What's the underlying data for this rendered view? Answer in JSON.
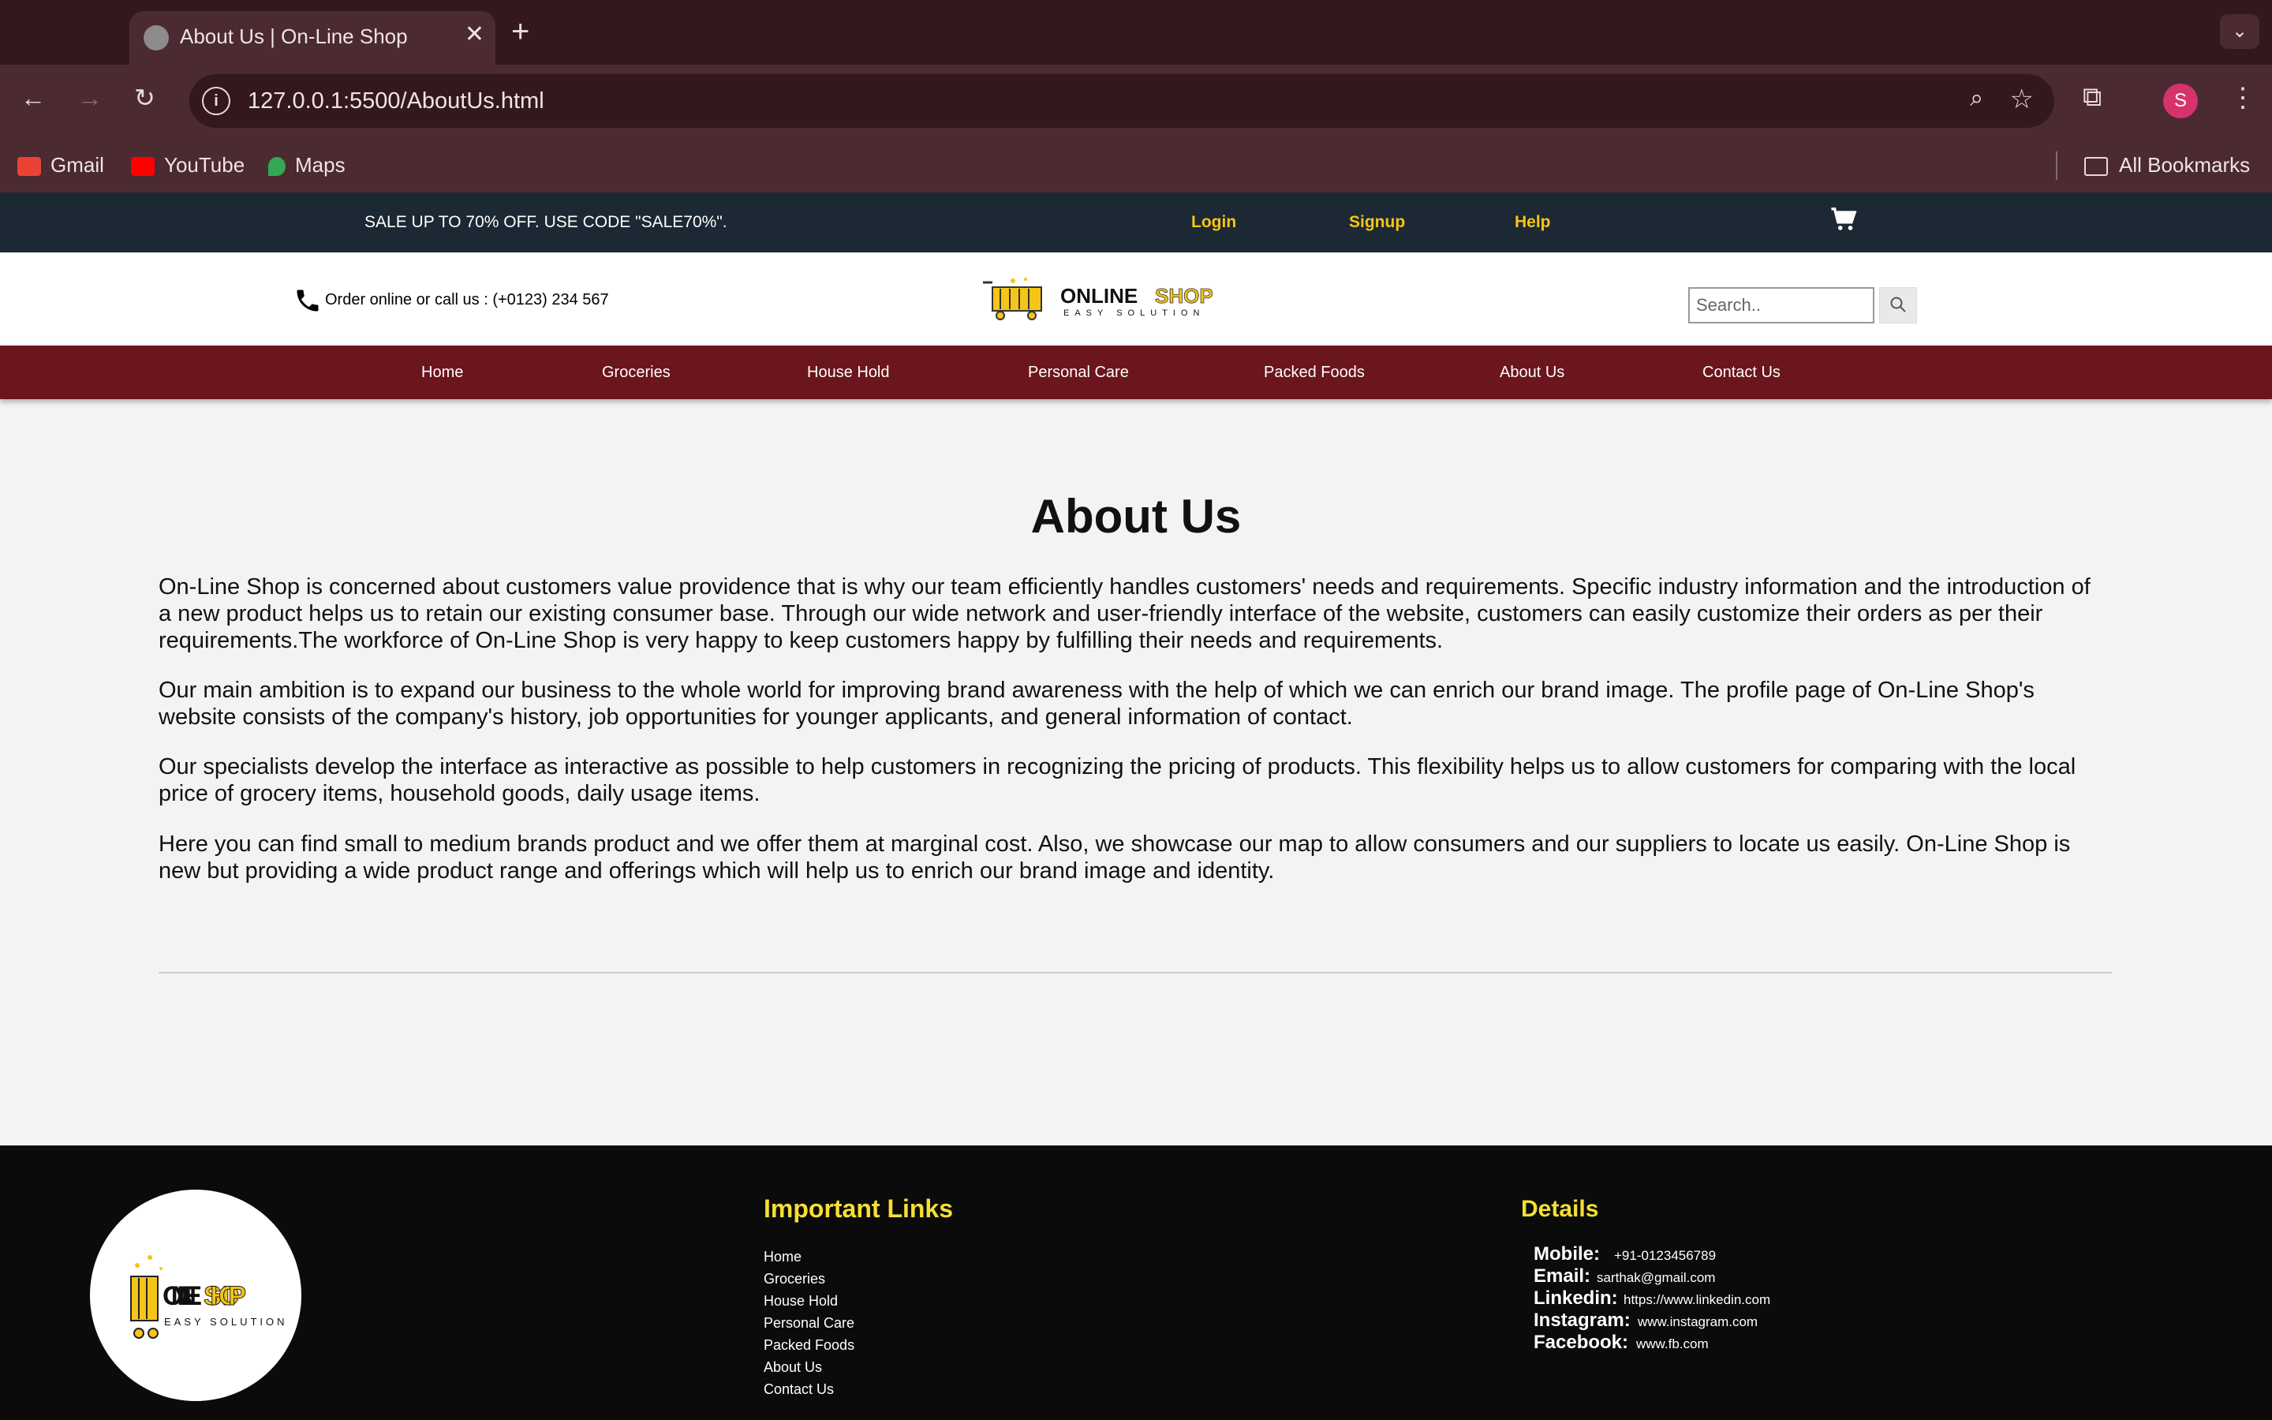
{
  "browser": {
    "tab_title": "About Us | On-Line Shop",
    "url": "127.0.0.1:5500/AboutUs.html",
    "avatar_letter": "S",
    "bookmarks": [
      "Gmail",
      "YouTube",
      "Maps"
    ],
    "all_bookmarks": "All Bookmarks"
  },
  "topbar": {
    "sale": "SALE UP TO 70% OFF. USE CODE \"SALE70%\".",
    "login": "Login",
    "signup": "Signup",
    "help": "Help"
  },
  "header": {
    "phone_text": "Order online or call us : (+0123) 234 567",
    "search_placeholder": "Search.."
  },
  "nav": [
    "Home",
    "Groceries",
    "House Hold",
    "Personal Care",
    "Packed Foods",
    "About Us",
    "Contact Us"
  ],
  "content": {
    "title": "About Us",
    "paragraphs": [
      "On-Line Shop is concerned about customers value providence that is why our team efficiently handles customers' needs and requirements. Specific industry information and the introduction of a new product helps us to retain our existing consumer base. Through our wide network and user-friendly interface of the website, customers can easily customize their orders as per their requirements.The workforce of On-Line Shop is very happy to keep customers happy by fulfilling their needs and requirements.",
      "Our main ambition is to expand our business to the whole world for improving brand awareness with the help of which we can enrich our brand image. The profile page of On-Line Shop's website consists of the company's history, job opportunities for younger applicants, and general information of contact.",
      "Our specialists develop the interface as interactive as possible to help customers in recognizing the pricing of products. This flexibility helps us to allow customers for comparing with the local price of grocery items, household goods, daily usage items.",
      "Here you can find small to medium brands product and we offer them at marginal cost. Also, we showcase our map to allow consumers and our suppliers to locate us easily. On-Line Shop is new but providing a wide product range and offerings which will help us to enrich our brand image and identity."
    ]
  },
  "footer": {
    "links_heading": "Important Links",
    "links": [
      "Home",
      "Groceries",
      "House Hold",
      "Personal Care",
      "Packed Foods",
      "About Us",
      "Contact Us"
    ],
    "details_heading": "Details",
    "details": [
      {
        "label": "Mobile:",
        "value": "+91-0123456789"
      },
      {
        "label": "Email:",
        "value": "sarthak@gmail.com"
      },
      {
        "label": "Linkedin:",
        "value": "https://www.linkedin.com"
      },
      {
        "label": "Instagram:",
        "value": "www.instagram.com"
      },
      {
        "label": "Facebook:",
        "value": "www.fb.com"
      }
    ]
  },
  "colors": {
    "topbar": "#1c2833",
    "nav": "#6b151c",
    "accent_yellow": "#f5c518",
    "footer": "#0b0b0b"
  },
  "icons": [
    "globe-icon",
    "close-icon",
    "plus-icon",
    "back-icon",
    "forward-icon",
    "reload-icon",
    "info-icon",
    "zoom-icon",
    "star-icon",
    "extensions-icon",
    "kebab-icon",
    "folder-icon",
    "cart-icon",
    "phone-icon",
    "search-icon"
  ]
}
